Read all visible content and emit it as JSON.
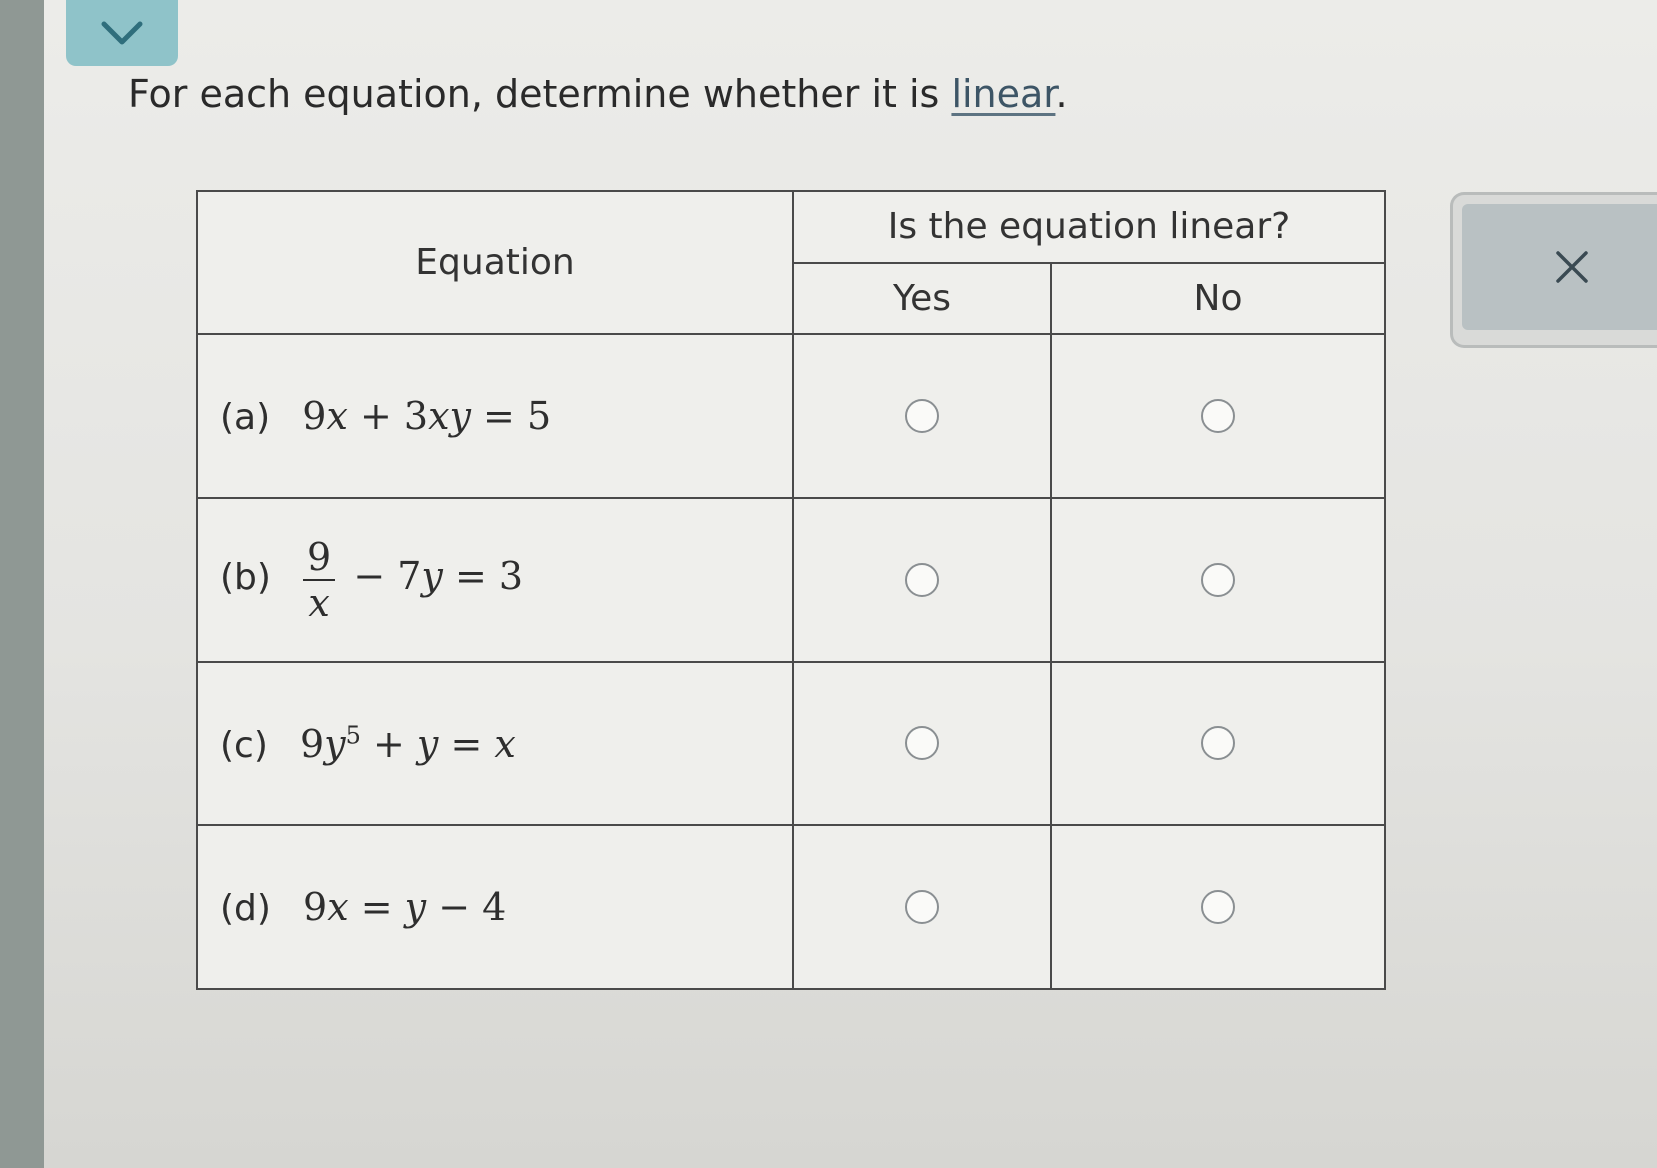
{
  "question": {
    "prompt_prefix": "For each equation, determine whether it is",
    "prompt_link": "linear",
    "prompt_suffix": "."
  },
  "table": {
    "equation_header": "Equation",
    "question_header": "Is the equation linear?",
    "yes_header": "Yes",
    "no_header": "No",
    "rows": [
      {
        "label": "(a)"
      },
      {
        "label": "(b)"
      },
      {
        "label": "(c)"
      },
      {
        "label": "(d)"
      }
    ]
  },
  "icons": {
    "collapse": "chevron-down-icon",
    "clear": "x-icon"
  },
  "colors": {
    "accent_tab": "#8fc3c9",
    "link": "#3d5566",
    "clear_button": "#b9c1c3"
  }
}
